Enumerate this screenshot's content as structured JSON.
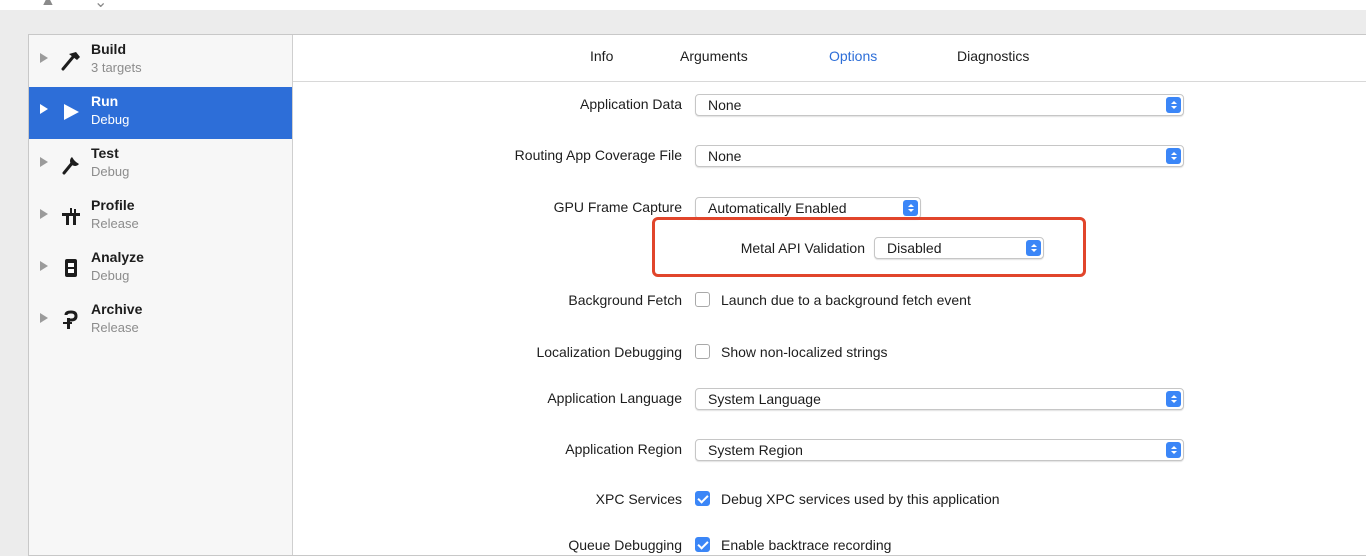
{
  "sidebar": {
    "items": [
      {
        "title": "Build",
        "subtitle": "3 targets",
        "icon": "hammer-icon",
        "selected": false
      },
      {
        "title": "Run",
        "subtitle": "Debug",
        "icon": "play-icon",
        "selected": true
      },
      {
        "title": "Test",
        "subtitle": "Debug",
        "icon": "wrench-icon",
        "selected": false
      },
      {
        "title": "Profile",
        "subtitle": "Release",
        "icon": "profile-icon",
        "selected": false
      },
      {
        "title": "Analyze",
        "subtitle": "Debug",
        "icon": "analyze-icon",
        "selected": false
      },
      {
        "title": "Archive",
        "subtitle": "Release",
        "icon": "archive-icon",
        "selected": false
      }
    ]
  },
  "tabs": [
    {
      "label": "Info",
      "active": false
    },
    {
      "label": "Arguments",
      "active": false
    },
    {
      "label": "Options",
      "active": true
    },
    {
      "label": "Diagnostics",
      "active": false
    }
  ],
  "options": {
    "app_data": {
      "label": "Application Data",
      "value": "None"
    },
    "routing": {
      "label": "Routing App Coverage File",
      "value": "None"
    },
    "gpu": {
      "label": "GPU Frame Capture",
      "value": "Automatically Enabled"
    },
    "metal": {
      "label": "Metal API Validation",
      "value": "Disabled"
    },
    "bg_fetch": {
      "label": "Background Fetch",
      "checkbox": "Launch due to a background fetch event",
      "checked": false
    },
    "loc_debug": {
      "label": "Localization Debugging",
      "checkbox": "Show non-localized strings",
      "checked": false
    },
    "app_lang": {
      "label": "Application Language",
      "value": "System Language"
    },
    "app_region": {
      "label": "Application Region",
      "value": "System Region"
    },
    "xpc": {
      "label": "XPC Services",
      "checkbox": "Debug XPC services used by this application",
      "checked": true
    },
    "queue": {
      "label": "Queue Debugging",
      "checkbox": "Enable backtrace recording",
      "checked": true
    }
  },
  "colors": {
    "accent": "#3b86f7",
    "selection": "#2d6ed8",
    "highlight": "#e1452b"
  }
}
